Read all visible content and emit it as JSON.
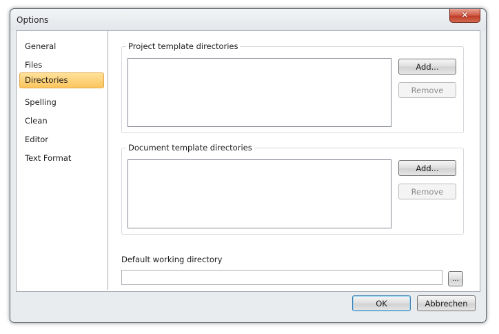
{
  "window": {
    "title": "Options",
    "close_glyph": "✕"
  },
  "nav": {
    "items": [
      {
        "label": "General",
        "selected": false
      },
      {
        "label": "Files",
        "selected": false
      },
      {
        "label": "Directories",
        "selected": true
      },
      {
        "label": "Spelling",
        "selected": false
      },
      {
        "label": "Clean",
        "selected": false
      },
      {
        "label": "Editor",
        "selected": false
      },
      {
        "label": "Text Format",
        "selected": false
      }
    ],
    "selected_color": "#fbc55e"
  },
  "project_templates": {
    "legend": "Project template directories",
    "items": [],
    "add_label": "Add...",
    "remove_label": "Remove",
    "remove_enabled": false
  },
  "document_templates": {
    "legend": "Document template directories",
    "items": [],
    "add_label": "Add...",
    "remove_label": "Remove",
    "remove_enabled": false
  },
  "working_directory": {
    "label": "Default working directory",
    "value": "",
    "browse_label": "..."
  },
  "footer": {
    "ok_label": "OK",
    "cancel_label": "Abbrechen"
  }
}
